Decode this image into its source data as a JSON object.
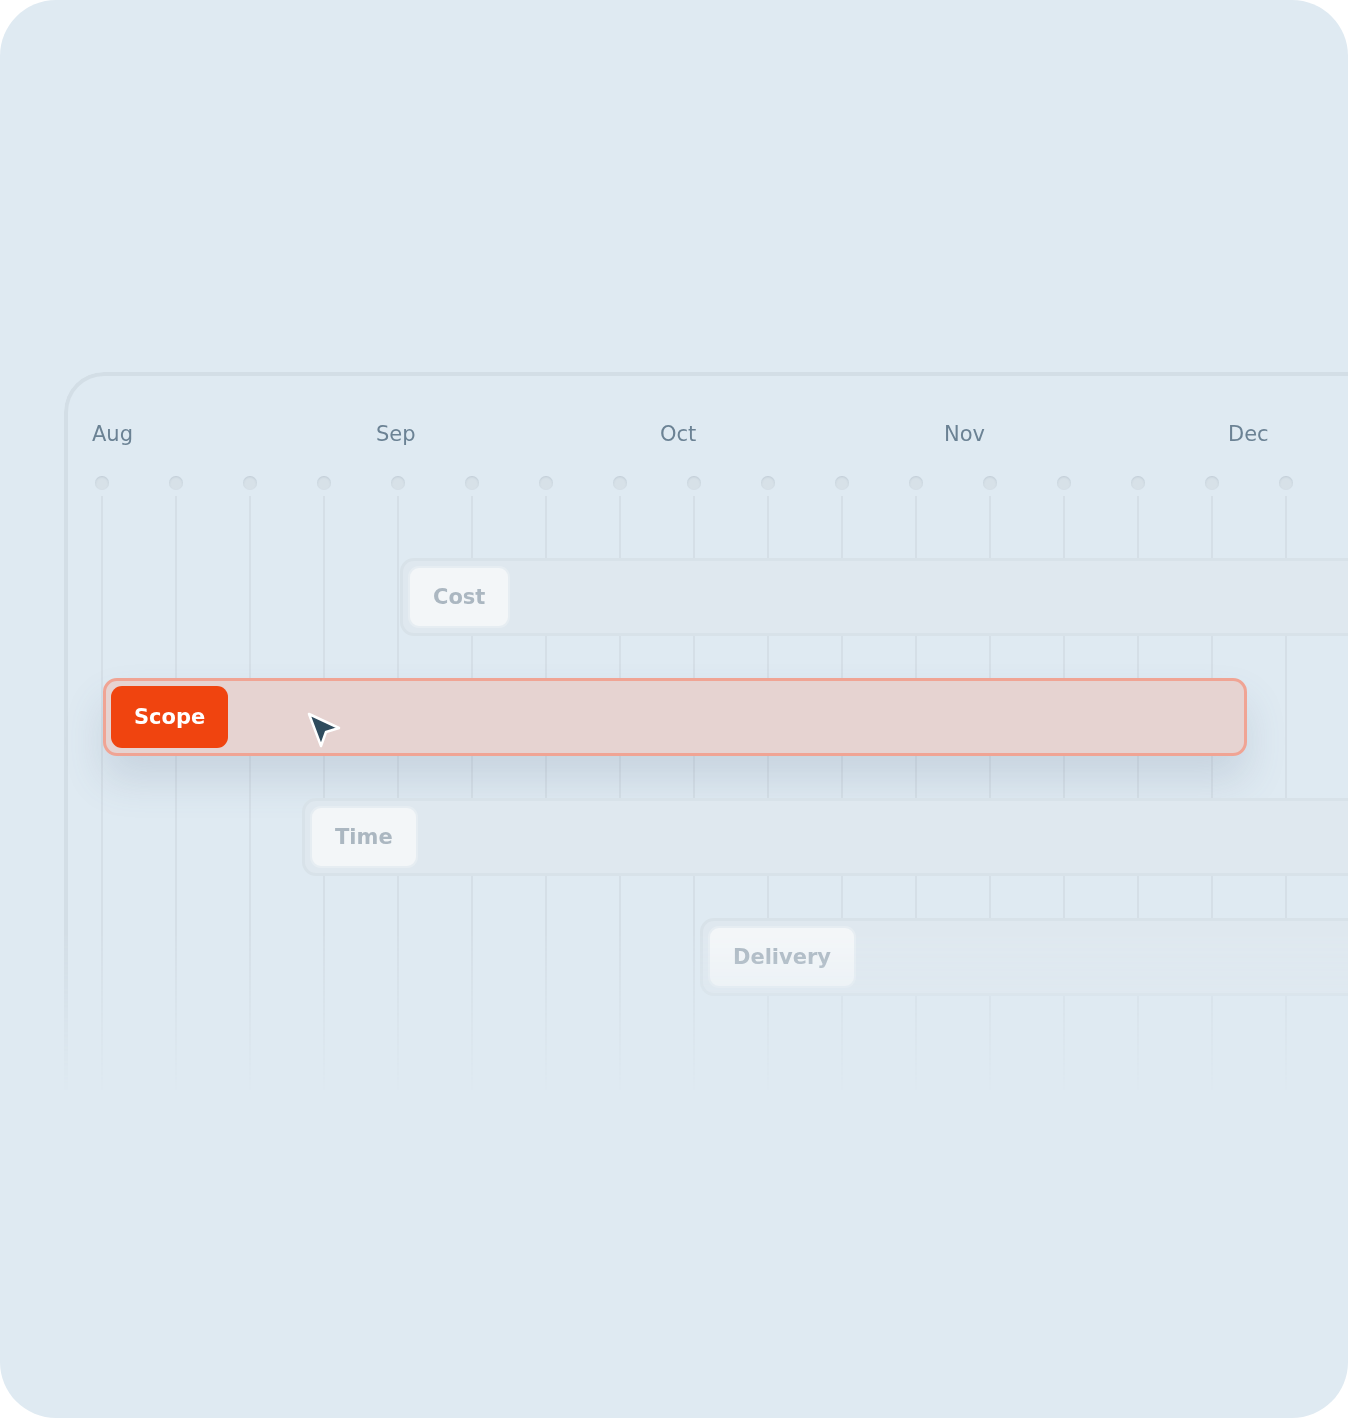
{
  "months": [
    "Aug",
    "Sep",
    "Oct",
    "Nov",
    "Dec"
  ],
  "bars": [
    {
      "label": "Cost",
      "selected": false
    },
    {
      "label": "Scope",
      "selected": true
    },
    {
      "label": "Time",
      "selected": false
    },
    {
      "label": "Delivery",
      "selected": false
    }
  ]
}
